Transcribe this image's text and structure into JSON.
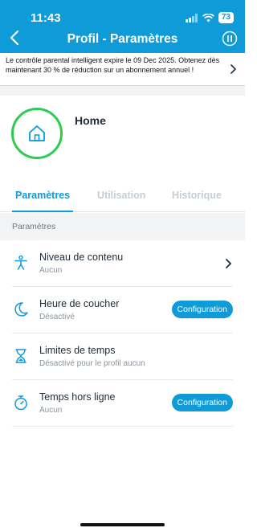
{
  "status_bar": {
    "time": "11:43",
    "battery": "73"
  },
  "nav": {
    "title": "Profil - Paramètres"
  },
  "banner": {
    "text": "Le contrôle parental intelligent expire le 09 Dec 2025. Obtenez dès maintenant 30 % de réduction sur un abonnement annuel !"
  },
  "profile": {
    "name": "Home"
  },
  "tabs": [
    {
      "label": "Paramètres",
      "active": true
    },
    {
      "label": "Utilisation",
      "active": false
    },
    {
      "label": "Historique",
      "active": false
    }
  ],
  "section": {
    "label": "Paramètres"
  },
  "rows": [
    {
      "title": "Niveau de contenu",
      "subtitle": "Aucun",
      "icon": "accessibility-person-icon",
      "action": "chevron"
    },
    {
      "title": "Heure de coucher",
      "subtitle": "Désactivé",
      "icon": "moon-icon",
      "action": "Configuration"
    },
    {
      "title": "Limites de temps",
      "subtitle": "Désactivé pour le profil aucun",
      "icon": "hourglass-icon",
      "action": "none"
    },
    {
      "title": "Temps hors ligne",
      "subtitle": "Aucun",
      "icon": "stopwatch-icon",
      "action": "Configuration"
    }
  ],
  "colors": {
    "accent": "#0f9ad8",
    "avatar_ring": "#2ecc52"
  }
}
